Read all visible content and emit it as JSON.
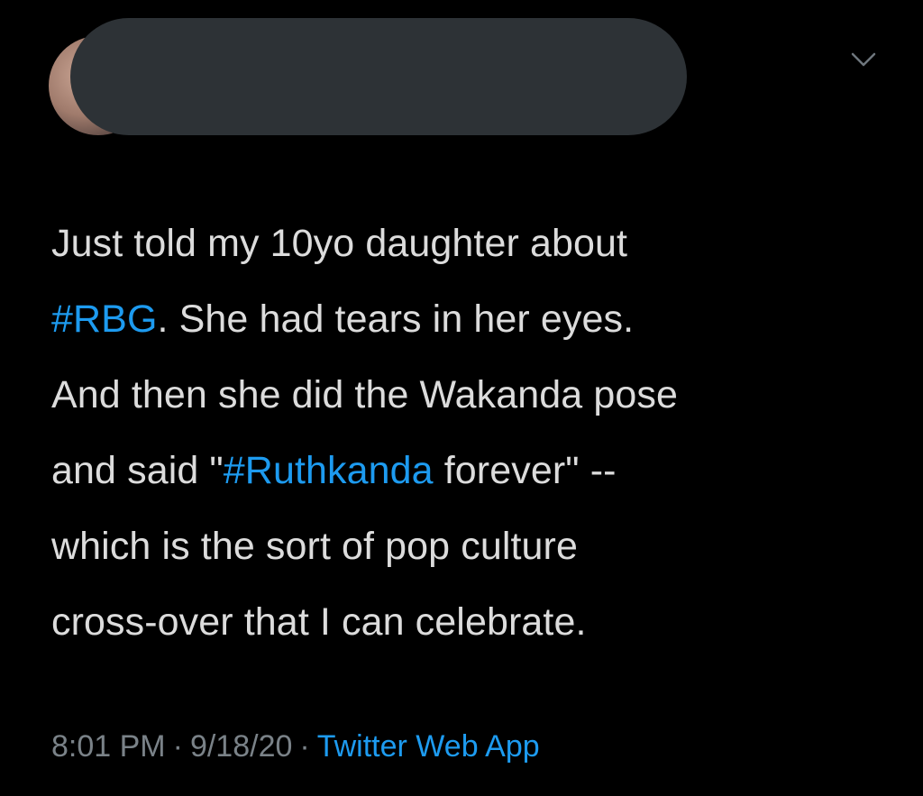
{
  "tweet": {
    "lines": [
      [
        {
          "text": "Just told my 10yo daughter about",
          "tag": false
        }
      ],
      [
        {
          "text": "#RBG",
          "tag": true
        },
        {
          "text": ". She had tears in her eyes.",
          "tag": false
        }
      ],
      [
        {
          "text": "And then she did the Wakanda pose",
          "tag": false
        }
      ],
      [
        {
          "text": "and said \"",
          "tag": false
        },
        {
          "text": "#Ruthkanda",
          "tag": true
        },
        {
          "text": " forever\" --",
          "tag": false
        }
      ],
      [
        {
          "text": "which is the sort of pop culture",
          "tag": false
        }
      ],
      [
        {
          "text": "cross-over that I can celebrate.",
          "tag": false
        }
      ]
    ],
    "time": "8:01 PM",
    "separator": "·",
    "date": "9/18/20",
    "source": "Twitter Web App"
  },
  "icons": {
    "menu": "chevron-down-icon",
    "avatar": "avatar"
  },
  "colors": {
    "background": "#000000",
    "text": "#dcdcdc",
    "link": "#1d9bf0",
    "meta": "#7a8288",
    "redaction": "#2d3236"
  }
}
